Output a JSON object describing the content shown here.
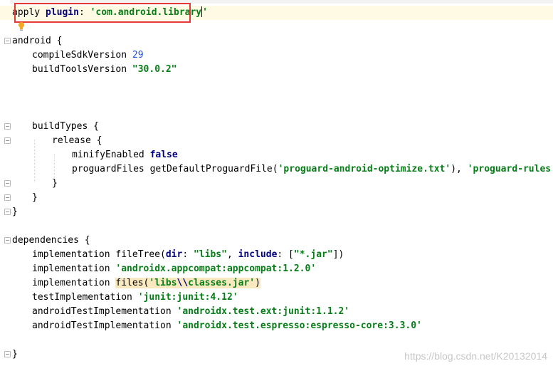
{
  "editor": {
    "line1": {
      "kw1": "apply",
      "kw2": "plugin",
      "colon": ": ",
      "q1": "'",
      "val": "com.android.library",
      "q2": "'"
    },
    "android": {
      "open": "android {",
      "compile_label": "compileSdkVersion ",
      "compile_val": "29",
      "build_tools_label": "buildToolsVersion ",
      "build_tools_val": "\"30.0.2\""
    },
    "buildTypes": {
      "open": "buildTypes {",
      "release_open": "release {",
      "minify_label": "minifyEnabled ",
      "minify_val": "false",
      "proguard_label": "proguardFiles getDefaultProguardFile(",
      "proguard_arg1": "'proguard-android-optimize.txt'",
      "proguard_sep": "), ",
      "proguard_arg2": "'proguard-rules.pro'",
      "close_inner": "}",
      "close_outer": "}"
    },
    "android_close": "}",
    "dependencies": {
      "open": "dependencies {",
      "d1_label": "implementation fileTree(",
      "d1_dir": "dir",
      "d1_colon1": ": ",
      "d1_libs": "\"libs\"",
      "d1_comma": ", ",
      "d1_include": "include",
      "d1_colon2": ": [",
      "d1_jar": "\"*.jar\"",
      "d1_close": "])",
      "d2_label": "implementation ",
      "d2_val": "'androidx.appcompat:appcompat:1.2.0'",
      "d3_label": "implementation ",
      "d3_files": "files(",
      "d3_q1": "'libs",
      "d3_esc": "\\\\",
      "d3_q2": "classes.jar'",
      "d3_close": ")",
      "d4_label": "testImplementation ",
      "d4_val": "'junit:junit:4.12'",
      "d5_label": "androidTestImplementation ",
      "d5_val": "'androidx.test.ext:junit:1.1.2'",
      "d6_label": "androidTestImplementation ",
      "d6_val": "'androidx.test.espresso:espresso-core:3.3.0'",
      "close": "}"
    }
  },
  "watermark": "https://blog.csdn.net/K20132014",
  "colors": {
    "keyword": "#000080",
    "string": "#067d17",
    "number": "#1750eb",
    "highlight_box": "#e53935",
    "current_line": "#fffae3"
  }
}
